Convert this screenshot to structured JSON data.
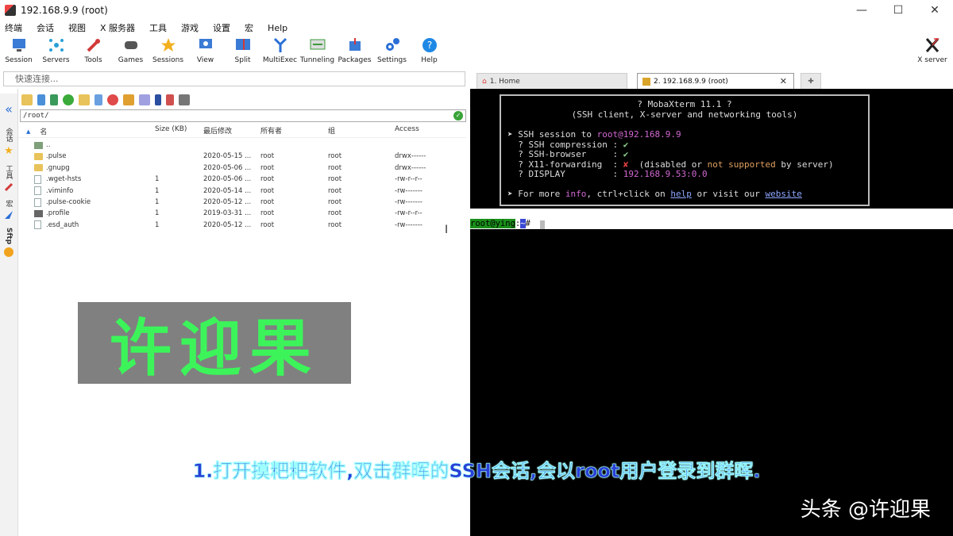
{
  "window": {
    "title": "192.168.9.9 (root)",
    "min": "—",
    "max": "☐",
    "close": "✕"
  },
  "menu": [
    "终端",
    "会话",
    "视图",
    "X 服务器",
    "工具",
    "游戏",
    "设置",
    "宏",
    "Help"
  ],
  "toolbar": [
    {
      "label": "Session",
      "icon": "session-icon",
      "color": "#3a7bd5"
    },
    {
      "label": "Servers",
      "icon": "servers-icon",
      "color": "#2a9fd6"
    },
    {
      "label": "Tools",
      "icon": "tools-icon",
      "color": "#d23a3a"
    },
    {
      "label": "Games",
      "icon": "games-icon",
      "color": "#555555"
    },
    {
      "label": "Sessions",
      "icon": "sessions-star-icon",
      "color": "#f2b01e"
    },
    {
      "label": "View",
      "icon": "view-icon",
      "color": "#3a7bd5"
    },
    {
      "label": "Split",
      "icon": "split-icon",
      "color": "#d23a3a"
    },
    {
      "label": "MultiExec",
      "icon": "multiexec-icon",
      "color": "#2a6fd6"
    },
    {
      "label": "Tunneling",
      "icon": "tunneling-icon",
      "color": "#3a9a3a"
    },
    {
      "label": "Packages",
      "icon": "packages-icon",
      "color": "#3a7bd5"
    },
    {
      "label": "Settings",
      "icon": "settings-gear-icon",
      "color": "#2a6fd6"
    },
    {
      "label": "Help",
      "icon": "help-icon",
      "color": "#1e88e5"
    }
  ],
  "xserver": {
    "label": "X server"
  },
  "quick_connect": {
    "placeholder": "快速连接..."
  },
  "sidebar_strip": [
    "«",
    "会话",
    "★",
    "工具",
    "宏",
    "Sftp"
  ],
  "file_browser": {
    "path": "/root/",
    "columns": [
      "名",
      "Size (KB)",
      "最后修改",
      "所有者",
      "组",
      "Access"
    ],
    "rows": [
      {
        "name": "..",
        "size": "",
        "modified": "",
        "owner": "",
        "group": "",
        "access": "",
        "type": "up"
      },
      {
        "name": ".pulse",
        "size": "",
        "modified": "2020-05-15 ...",
        "owner": "root",
        "group": "root",
        "access": "drwx------",
        "type": "folder"
      },
      {
        "name": ".gnupg",
        "size": "",
        "modified": "2020-05-06 ...",
        "owner": "root",
        "group": "root",
        "access": "drwx------",
        "type": "folder"
      },
      {
        "name": ".wget-hsts",
        "size": "1",
        "modified": "2020-05-06 ...",
        "owner": "root",
        "group": "root",
        "access": "-rw-r--r--",
        "type": "file"
      },
      {
        "name": ".viminfo",
        "size": "1",
        "modified": "2020-05-14 ...",
        "owner": "root",
        "group": "root",
        "access": "-rw-------",
        "type": "file"
      },
      {
        "name": ".pulse-cookie",
        "size": "1",
        "modified": "2020-05-12 ...",
        "owner": "root",
        "group": "root",
        "access": "-rw-------",
        "type": "file"
      },
      {
        "name": ".profile",
        "size": "1",
        "modified": "2019-03-31 ...",
        "owner": "root",
        "group": "root",
        "access": "-rw-r--r--",
        "type": "dark"
      },
      {
        "name": ".esd_auth",
        "size": "1",
        "modified": "2020-05-12 ...",
        "owner": "root",
        "group": "root",
        "access": "-rw-------",
        "type": "file"
      }
    ]
  },
  "overlay_watermark": "许迎果",
  "tabs": {
    "home": "1. Home",
    "ssh": "2. 192.168.9.9 (root)",
    "close": "✕",
    "add": "✚"
  },
  "terminal": {
    "header1": "? MobaXterm 11.1 ?",
    "header2": "(SSH client, X-server and networking tools)",
    "ssh_session_prefix": "➤ SSH session to ",
    "ssh_user": "root",
    "ssh_host": "@192.168.9.9",
    "compression": "  ? SSH compression : ",
    "browser": "  ? SSH-browser     : ",
    "check": "✔",
    "x11": "  ? X11-forwarding  : ",
    "cross": "✘",
    "x11_note_a": "  (disabled or ",
    "x11_note_b": "not supported",
    "x11_note_c": " by server)",
    "display": "  ? DISPLAY         : ",
    "display_val": "192.168.9.53:0.0",
    "more_a": "➤ For more ",
    "more_info": "info",
    "more_b": ", ctrl+click on ",
    "more_help": "help",
    "more_c": " or visit our ",
    "more_site": "website",
    "prompt_user": "root@ying",
    "prompt_sep": ":",
    "prompt_path": "~",
    "prompt_hash": "#"
  },
  "subtitle": "1.打开摸粑粑软件,双击群晖的SSH会话,会以root用户登录到群晖.",
  "brand_watermark": "头条 @许迎果"
}
